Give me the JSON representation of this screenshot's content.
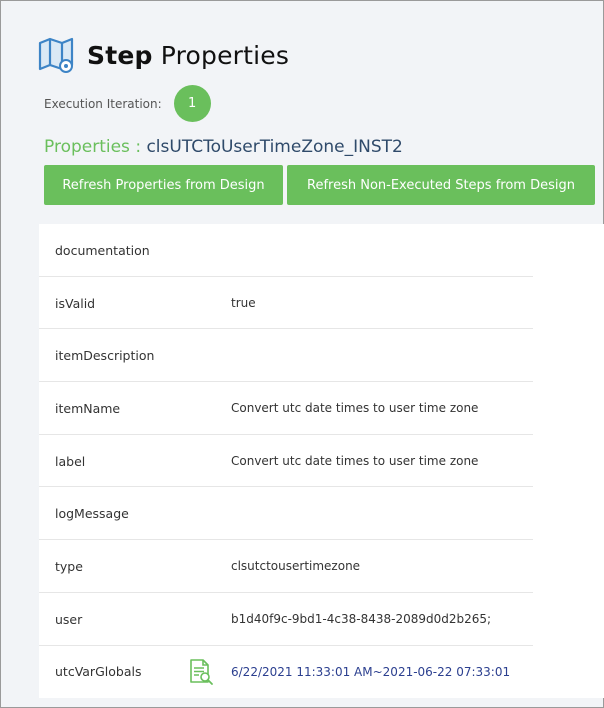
{
  "header": {
    "title_bold": "Step",
    "title_rest": "Properties",
    "icon": "map-icon"
  },
  "iteration": {
    "label": "Execution Iteration:",
    "value": "1"
  },
  "properties": {
    "label": "Properties :",
    "name": "clsUTCToUserTimeZone_INST2"
  },
  "buttons": {
    "refresh_design": "Refresh Properties from Design",
    "refresh_non_executed": "Refresh Non-Executed Steps from Design"
  },
  "rows": [
    {
      "key": "documentation",
      "value": ""
    },
    {
      "key": "isValid",
      "value": "true"
    },
    {
      "key": "itemDescription",
      "value": ""
    },
    {
      "key": "itemName",
      "value": "Convert utc date times to user time zone"
    },
    {
      "key": "label",
      "value": "Convert utc date times to user time zone"
    },
    {
      "key": "logMessage",
      "value": ""
    },
    {
      "key": "type",
      "value": "clsutctousertimezone"
    },
    {
      "key": "user",
      "value": "b1d40f9c-9bd1-4c38-8438-2089d0d2b265;"
    },
    {
      "key": "utcVarGlobals",
      "value": "6/22/2021 11:33:01 AM~2021-06-22 07:33:01",
      "icon": "document-search-icon"
    }
  ],
  "colors": {
    "accent_green": "#6abf5c",
    "link_blue": "#2b3f8f",
    "heading_navy": "#2f4a6a"
  }
}
